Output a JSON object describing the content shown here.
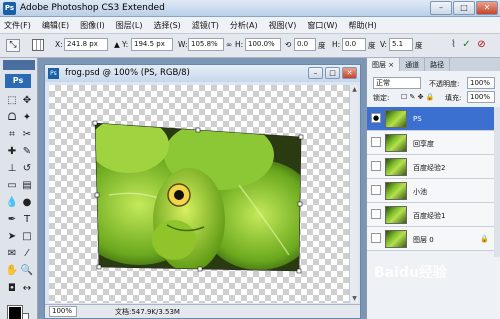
{
  "app": {
    "title": "Adobe Photoshop CS3 Extended",
    "logo": "Ps"
  },
  "window_controls": {
    "minimize": "–",
    "maximize": "□",
    "close": "✕"
  },
  "menu": [
    "文件(F)",
    "编辑(E)",
    "图像(I)",
    "图层(L)",
    "选择(S)",
    "滤镜(T)",
    "分析(A)",
    "视图(V)",
    "窗口(W)",
    "帮助(H)"
  ],
  "options": {
    "x_label": "X:",
    "x_value": "241.8 px",
    "y_label": "Y:",
    "y_value": "194.5 px",
    "w_label": "W:",
    "w_value": "105.8%",
    "h_label": "H:",
    "h_value": "100.0%",
    "angle_value": "0.0",
    "angle_unit": "度",
    "hskew_label": "H:",
    "hskew_value": "0.0",
    "hskew_unit": "度",
    "vskew_label": "V:",
    "vskew_value": "5.1",
    "vskew_unit": "度"
  },
  "toolbox": {
    "badge": "Ps"
  },
  "document": {
    "title": "frog.psd @ 100% (PS, RGB/8)",
    "zoom": "100%",
    "info": "文档:547.9K/3.53M"
  },
  "layers_panel": {
    "tabs": [
      "图层 ×",
      "通道",
      "路径"
    ],
    "blend_mode": "正常",
    "opacity_label": "不透明度:",
    "opacity_value": "100%",
    "lock_label": "锁定:",
    "fill_label": "填充:",
    "fill_value": "100%",
    "layers": [
      {
        "name": "PS",
        "selected": true,
        "visible": true
      },
      {
        "name": "回享度",
        "selected": false,
        "visible": false
      },
      {
        "name": "百度经验2",
        "selected": false,
        "visible": false
      },
      {
        "name": "小池",
        "selected": false,
        "visible": false
      },
      {
        "name": "百度经验1",
        "selected": false,
        "visible": false
      },
      {
        "name": "图层 0",
        "selected": false,
        "visible": false,
        "locked": true
      }
    ]
  },
  "watermark": "Baidu经验"
}
